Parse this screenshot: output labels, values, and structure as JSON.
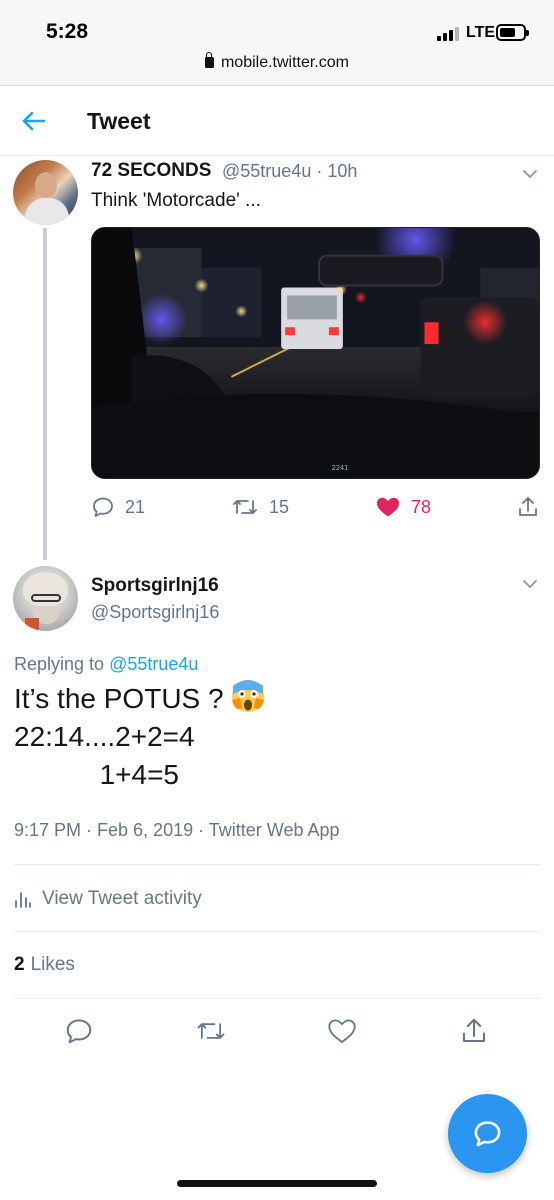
{
  "status": {
    "time": "5:28",
    "network": "LTE"
  },
  "browser": {
    "url": "mobile.twitter.com"
  },
  "header": {
    "title": "Tweet",
    "back_icon": "arrow-left-icon"
  },
  "colors": {
    "accent": "#1da1f2",
    "like": "#e0245e",
    "muted": "#657786",
    "fab": "#2a96f0"
  },
  "thread_tweet": {
    "name": "72 SECONDS",
    "handle_time": "@55true4u · 10h",
    "text": "Think 'Motorcade' ...",
    "photo_overlay_text": "2241",
    "reply_count": "21",
    "retweet_count": "15",
    "like_count": "78",
    "liked": true
  },
  "main_tweet": {
    "name": "Sportsgirlnj16",
    "handle": "@Sportsgirlnj16",
    "replying_prefix": "Replying to",
    "replying_to": "@55true4u",
    "line1": "It’s the POTUS ?",
    "line2": "22:14....2+2=4",
    "line3": "           1+4=5",
    "emoji": "face-screaming-in-fear",
    "timestamp": "9:17 PM · Feb 6, 2019 · ",
    "source": "Twitter Web App",
    "activity_label": "View Tweet activity",
    "likes_count": "2",
    "likes_label": "Likes"
  }
}
